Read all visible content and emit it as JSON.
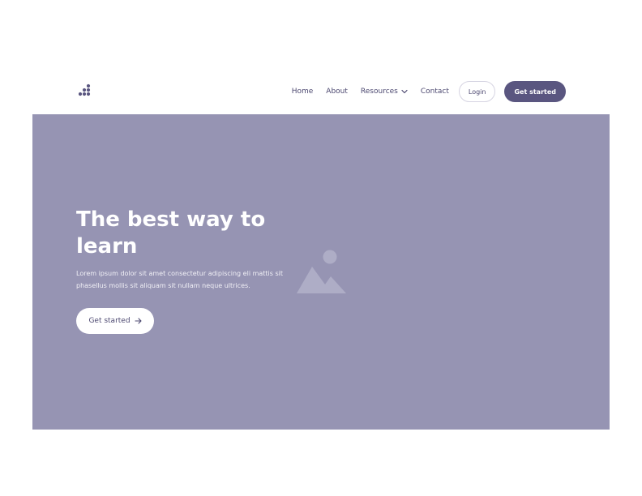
{
  "header": {
    "logo": "dots-logo-icon",
    "nav": [
      {
        "label": "Home"
      },
      {
        "label": "About"
      },
      {
        "label": "Resources",
        "icon": "chevron-down-icon"
      },
      {
        "label": "Contact"
      }
    ],
    "login_label": "Login",
    "cta_label": "Get started"
  },
  "hero": {
    "title": "The best way to learn",
    "subtitle": "Lorem ipsum dolor sit amet consectetur adipiscing eli mattis sit phasellus mollis sit aliquam sit nullam neque ultrices.",
    "button_label": "Get started",
    "button_icon": "arrow-right-icon",
    "image_icon": "image-placeholder-icon"
  },
  "colors": {
    "accent": "#5a5680",
    "hero_bg": "#9694b3",
    "text": "#4c4870"
  }
}
